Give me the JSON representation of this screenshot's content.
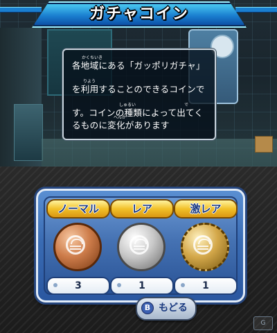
{
  "top": {
    "title": "ガチャコイン",
    "description": {
      "lines": [
        "各地域にある「ガッポリガチャ」",
        "を利用することのできるコインで",
        "す。コインの種類によって出てく",
        "るものに変化があります"
      ],
      "ruby": {
        "kakuchiiki": "かくちいき",
        "riyou": "りよう",
        "shurui": "しゅるい",
        "de": "で",
        "henka": "へんか"
      }
    }
  },
  "coins": [
    {
      "label": "ノーマル",
      "count": "3",
      "material": "bronze"
    },
    {
      "label": "レア",
      "count": "1",
      "material": "silver"
    },
    {
      "label": "激レア",
      "count": "1",
      "material": "gold"
    }
  ],
  "back_button": {
    "icon": "B",
    "label": "もどる"
  },
  "colors": {
    "panel_blue": "#3a6cb4",
    "label_gold": "#f2c12a",
    "title_cyan": "#4fd2f5"
  }
}
